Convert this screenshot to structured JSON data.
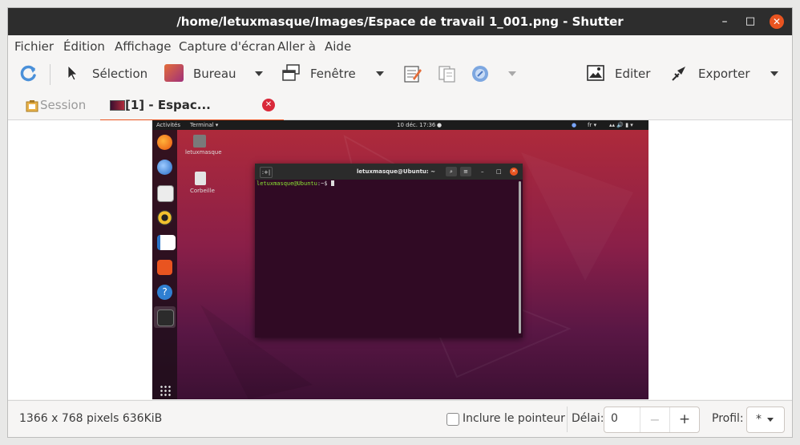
{
  "window": {
    "title": "/home/letuxmasque/Images/Espace de travail 1_001.png - Shutter",
    "minimize": "–",
    "maximize": "□",
    "close": "✕"
  },
  "menubar": [
    "Fichier",
    "Édition",
    "Affichage",
    "Capture d'écran",
    "Aller à",
    "Aide"
  ],
  "toolbar": {
    "selection": "Sélection",
    "desktop": "Bureau",
    "window": "Fenêtre",
    "edit": "Editer",
    "export": "Exporter"
  },
  "tabs": {
    "session": "Session",
    "active": "[1] - Espac... 1_001.png"
  },
  "preview": {
    "activities": "Activités",
    "terminal_menu": "Terminal ▾",
    "clock": "10 déc. 17:36",
    "lang": "fr ▾",
    "home_label": "letuxmasque",
    "trash_label": "Corbeille",
    "term_title": "letuxmasque@Ubuntu: ~",
    "prompt_user": "letuxmasque@Ubuntu",
    "prompt_rest": ":~$"
  },
  "statusbar": {
    "info": "1366 x 768 pixels  636KiB",
    "pointer": "Inclure le pointeur",
    "delay_label": "Délai:",
    "delay_value": "0",
    "minus": "−",
    "plus": "+",
    "profile_label": "Profil:",
    "profile_value": "*"
  },
  "colors": {
    "accent": "#e95420",
    "titlebar": "#2d2d2d"
  }
}
